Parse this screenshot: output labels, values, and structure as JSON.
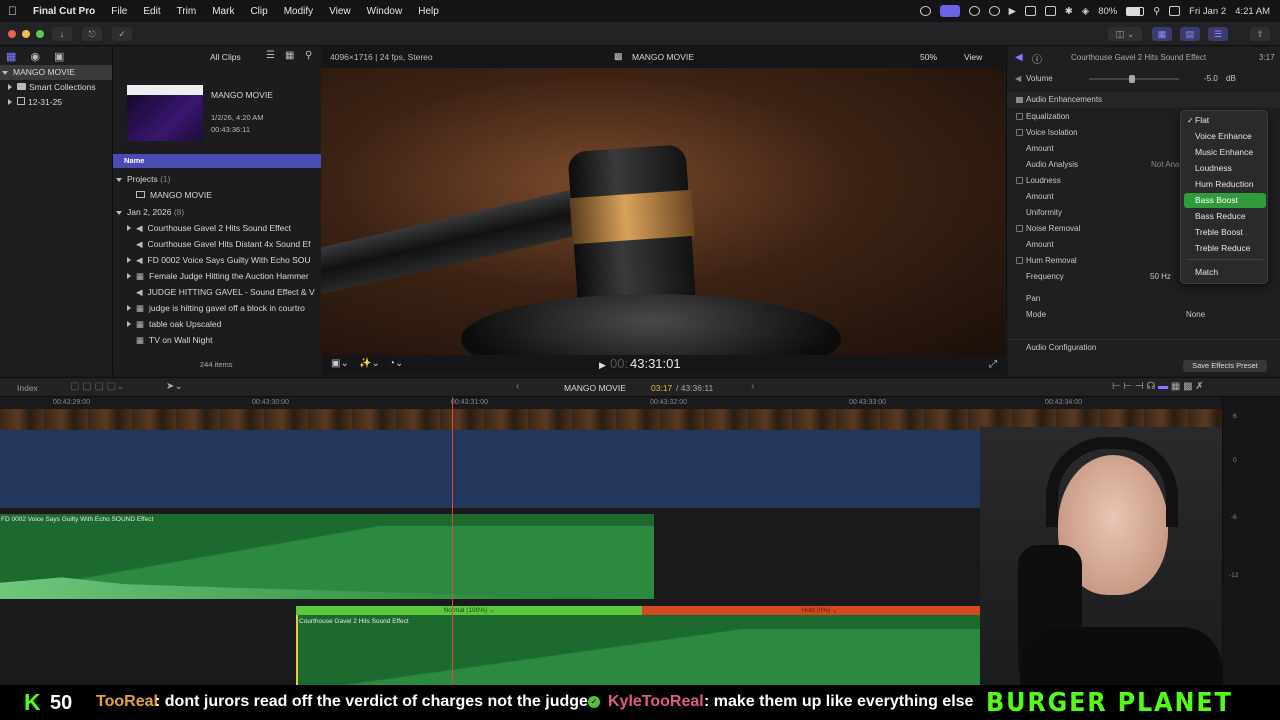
{
  "menubar": {
    "app": "Final Cut Pro",
    "items": [
      "File",
      "Edit",
      "Trim",
      "Mark",
      "Clip",
      "Modify",
      "View",
      "Window",
      "Help"
    ],
    "battery": "80%",
    "date": "Fri Jan 2",
    "time": "4:21 AM"
  },
  "library": {
    "name": "MANGO MOVIE",
    "items": [
      "Smart Collections",
      "12-31-25"
    ]
  },
  "browser": {
    "filter": "All Clips",
    "clip_title": "MANGO MOVIE",
    "clip_date": "1/2/26, 4:20 AM",
    "clip_duration": "00:43:36:11",
    "column_header": "Name",
    "projects_label": "Projects",
    "projects_count": "(1)",
    "project_item": "MANGO MOVIE",
    "date_group": "Jan 2, 2026",
    "date_count": "(8)",
    "clips": [
      "Courthouse Gavel 2 Hits Sound Effect",
      "Courthouse Gavel Hits Distant 4x Sound Ef",
      "FD 0002   Voice Says Guilty With Echo SOU",
      "Female Judge Hitting the Auction Hammer",
      "JUDGE HITTING GAVEL - Sound Effect & V",
      "judge is hitting gavel off a block in courtro",
      "table oak Upscaled",
      "TV on Wall Night"
    ],
    "item_count": "244 items"
  },
  "viewer": {
    "format": "4096×1716 | 24 fps, Stereo",
    "title": "MANGO MOVIE",
    "zoom": "50%",
    "view_label": "View",
    "timecode": "43:31:01",
    "timecode_dim": "00:"
  },
  "inspector": {
    "clip_name": "Courthouse Gavel 2 Hits Sound Effect",
    "duration": "3:17",
    "volume_label": "Volume",
    "volume_value": "-5.0",
    "volume_unit": "dB",
    "section": "Audio Enhancements",
    "rows": [
      "Equalization",
      "Voice Isolation",
      "Amount",
      "Audio Analysis",
      "Loudness",
      "Amount",
      "Uniformity",
      "Noise Removal",
      "Amount",
      "Hum Removal",
      "Frequency"
    ],
    "analysis_value": "Not Ana",
    "freq_value": "50 Hz",
    "pan_label": "Pan",
    "mode_label": "Mode",
    "mode_value": "None",
    "audio_config": "Audio Configuration",
    "save_preset": "Save Effects Preset"
  },
  "eq_menu": {
    "items": [
      "Flat",
      "Voice Enhance",
      "Music Enhance",
      "Loudness",
      "Hum Reduction",
      "Bass Boost",
      "Bass Reduce",
      "Treble Boost",
      "Treble Reduce",
      "Match"
    ],
    "checked": "Flat",
    "selected": "Bass Boost"
  },
  "timeline": {
    "index_label": "Index",
    "project": "MANGO MOVIE",
    "position": "03:17",
    "total": "/ 43:36:11",
    "ruler": [
      "00:43:29:00",
      "00:43:30:00",
      "00:43:31:00",
      "00:43:32:00",
      "00:43:33:00",
      "00:43:34:00"
    ],
    "meter": [
      "6",
      "0",
      "-6",
      "-12"
    ],
    "clip_a": "FD 0002   Voice Says Guilty With Echo SOUND Effect",
    "clip_b": "Courthouse Gavel 2 Hits Sound Effect",
    "retime_normal": "Normal (100%)",
    "retime_hold": "Hold (0%)"
  },
  "ticker": {
    "badge": "K",
    "count": "50",
    "user1": "TooReal",
    "msg1": ": dont jurors read off the verdict of charges not the judge",
    "user2": "KyleTooReal",
    "msg2": ": make them up like everything else",
    "brand": "BURGER PLANET"
  },
  "colors": {
    "accent": "#5b5cf0",
    "selection_green": "#2f9b3a",
    "clip_green": "#1f7a34",
    "retime_green": "#5cc93a",
    "retime_red": "#d34a1e"
  }
}
